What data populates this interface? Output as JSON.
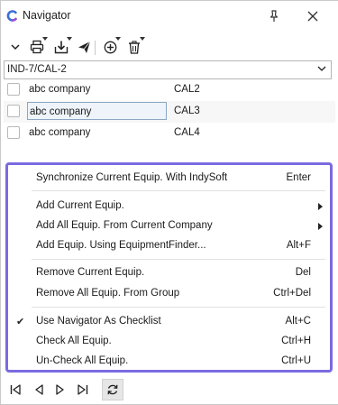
{
  "window": {
    "title": "Navigator",
    "app_icon": "indysoft-logo-icon",
    "controls": {
      "pin": "pin-icon",
      "close": "close-icon"
    }
  },
  "toolbar": {
    "items": [
      {
        "name": "collapse",
        "icon": "chevron-down-icon"
      },
      {
        "name": "print",
        "icon": "printer-icon",
        "has_dropdown": true
      },
      {
        "name": "export",
        "icon": "download-tray-icon",
        "has_dropdown": true
      },
      {
        "name": "send",
        "icon": "paper-plane-icon"
      },
      {
        "name": "add",
        "icon": "plus-circle-icon",
        "has_dropdown": true
      },
      {
        "name": "delete",
        "icon": "trash-icon",
        "has_dropdown": true
      }
    ]
  },
  "group_select": {
    "value": "IND-7/CAL-2"
  },
  "list": {
    "rows": [
      {
        "company": "abc company",
        "code": "CAL2",
        "checked": false,
        "focused": false
      },
      {
        "company": "abc company",
        "code": "CAL3",
        "checked": false,
        "focused": true
      },
      {
        "company": "abc company",
        "code": "CAL4",
        "checked": false,
        "focused": false
      }
    ]
  },
  "context_menu": {
    "items": [
      {
        "label": "Synchronize Current Equip. With IndySoft",
        "shortcut": "Enter"
      },
      {
        "separator": true
      },
      {
        "label": "Add Current Equip.",
        "submenu": true
      },
      {
        "label": "Add All Equip. From Current Company",
        "submenu": true
      },
      {
        "label": "Add Equip. Using EquipmentFinder...",
        "shortcut": "Alt+F"
      },
      {
        "separator": true
      },
      {
        "label": "Remove Current Equip.",
        "shortcut": "Del"
      },
      {
        "label": "Remove All Equip. From Group",
        "shortcut": "Ctrl+Del"
      },
      {
        "separator": true
      },
      {
        "label": "Use Navigator As Checklist",
        "shortcut": "Alt+C",
        "checked": true,
        "check_glyph": "✔"
      },
      {
        "label": "Check All Equip.",
        "shortcut": "Ctrl+H"
      },
      {
        "label": "Un-Check All Equip.",
        "shortcut": "Ctrl+U"
      }
    ]
  },
  "bottom_nav": {
    "items": [
      {
        "name": "first",
        "icon": "first-record-icon"
      },
      {
        "name": "prev",
        "icon": "previous-record-icon"
      },
      {
        "name": "next",
        "icon": "next-record-icon"
      },
      {
        "name": "last",
        "icon": "last-record-icon"
      },
      {
        "name": "refresh",
        "icon": "refresh-icon"
      }
    ]
  },
  "colors": {
    "menu_border": "#7b6be0",
    "logo_blue": "#3b6fd8",
    "logo_purple": "#9b4fd8",
    "focus_border": "#8ba7c3"
  }
}
